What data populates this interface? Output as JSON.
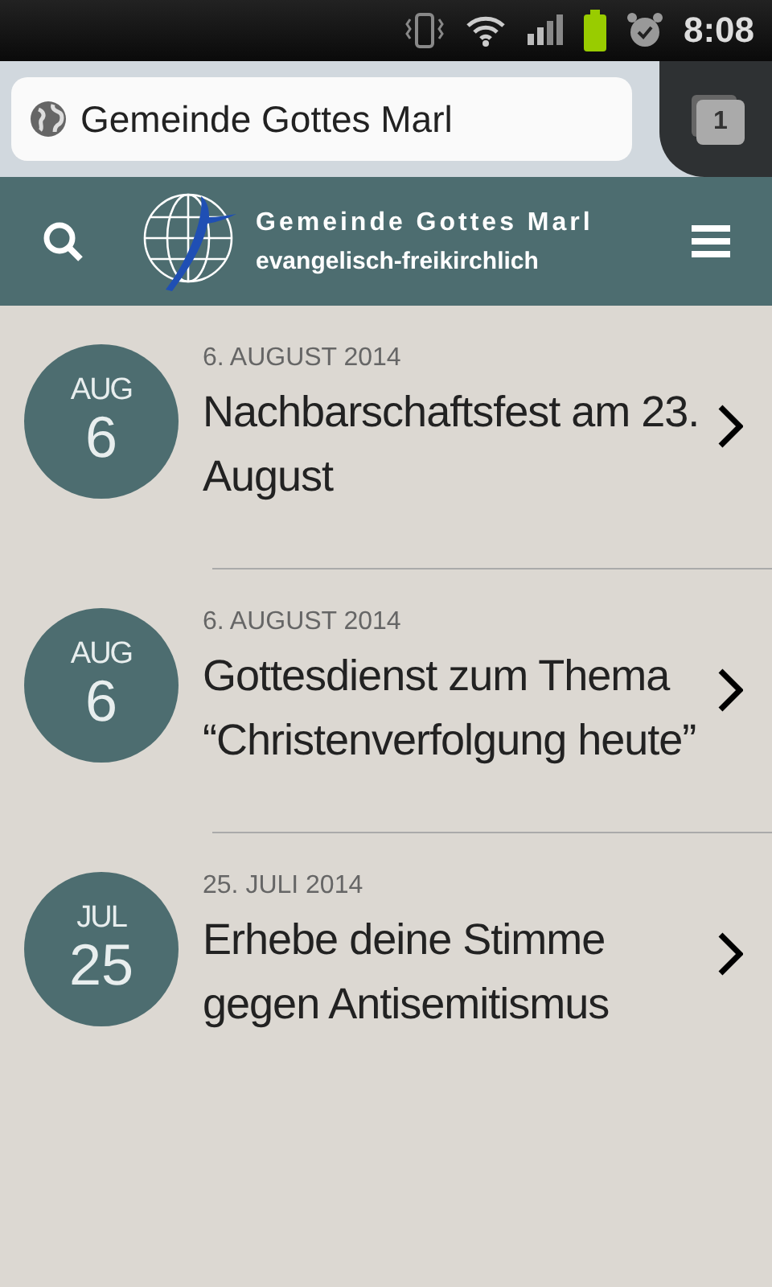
{
  "status_bar": {
    "time": "8:08"
  },
  "browser": {
    "address": "Gemeinde Gottes Marl",
    "tab_count": "1"
  },
  "header": {
    "title": "Gemeinde Gottes Marl",
    "subtitle": "evangelisch-freikirchlich"
  },
  "posts": [
    {
      "month": "AUG",
      "day": "6",
      "date": "6. AUGUST 2014",
      "title": "Nachbarschaftsfest am 23. August"
    },
    {
      "month": "AUG",
      "day": "6",
      "date": "6. AUGUST 2014",
      "title": "Gottesdienst zum Thema “Christenverfolgung heute”"
    },
    {
      "month": "JUL",
      "day": "25",
      "date": "25. JULI 2014",
      "title": "Erhebe deine Stimme gegen Antisemitismus"
    }
  ]
}
